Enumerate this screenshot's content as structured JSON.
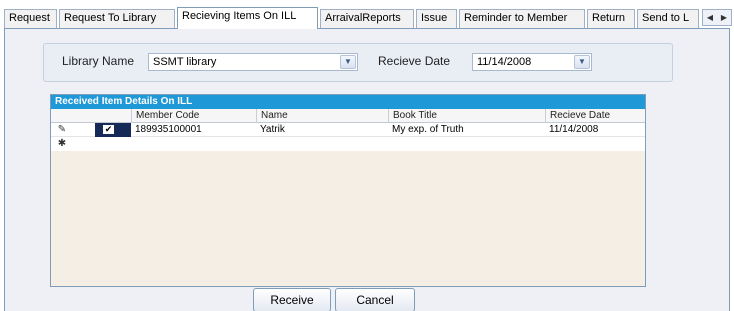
{
  "tabs": [
    {
      "label": "Request"
    },
    {
      "label": "Request To Library"
    },
    {
      "label": "Recieving Items On ILL"
    },
    {
      "label": "ArraivalReports"
    },
    {
      "label": "Issue"
    },
    {
      "label": "Reminder to Member"
    },
    {
      "label": "Return"
    },
    {
      "label": "Send to L"
    }
  ],
  "active_tab": "Recieving Items On ILL",
  "filter": {
    "library_label": "Library Name",
    "library_value": "SSMT library",
    "date_label": "Recieve Date",
    "date_value": "11/14/2008"
  },
  "grid": {
    "caption": "Received Item Details On ILL",
    "columns": [
      "Member Code",
      "Name",
      "Book Title",
      "Recieve Date"
    ],
    "rows": [
      {
        "checked": true,
        "member_code": "189935100001",
        "name": "Yatrik",
        "book_title": "My exp. of Truth",
        "recieve_date": "11/14/2008"
      }
    ]
  },
  "buttons": {
    "receive": "Receive",
    "cancel": "Cancel"
  },
  "icons": {
    "edit_row": "pencil-icon",
    "new_row": "asterisk-icon",
    "dropdown": "chevron-down-icon",
    "tab_scroll": "chevron-left-right-icon"
  },
  "colors": {
    "caption_bar": "#1f98d8",
    "selected_cell": "#162a58"
  }
}
